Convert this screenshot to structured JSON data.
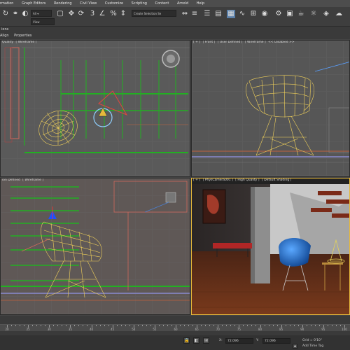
{
  "menubar": {
    "items": [
      "rmation",
      "Graph Editors",
      "Rendering",
      "Civil View",
      "Customize",
      "Scripting",
      "Content",
      "Arnold",
      "Help"
    ]
  },
  "toolbar": {
    "reference_system": "View",
    "selection_set": "Create Selection Se"
  },
  "tabs": {
    "row1_item": "ions",
    "row2_items": [
      "Align",
      "Properties"
    ]
  },
  "viewports": {
    "top": {
      "labels": [
        "Quality",
        "[ Wireframe ]"
      ]
    },
    "front": {
      "labels": [
        "[ + ]",
        "[ Front ]",
        "[ User Defined ]",
        "[ Wireframe ]",
        "<< Disabled >>"
      ]
    },
    "left": {
      "labels": [
        "ion Defined",
        "[ Wireframe ]"
      ]
    },
    "camera": {
      "labels": [
        "[ + ]",
        "[ PhysCamera001 ]",
        "[ High Quality ]",
        "[ Default Shading ]"
      ]
    }
  },
  "timeline": {
    "ticks": [
      "20",
      "25",
      "30",
      "35",
      "40",
      "45",
      "50",
      "55",
      "60",
      "65",
      "70",
      "75",
      "80",
      "85",
      "90",
      "95",
      "100"
    ]
  },
  "statusbar": {
    "x_label": "X:",
    "x_value": "72.096",
    "y_label": "Y:",
    "y_value": "72.096",
    "grid_label": "Grid = 0'10\"",
    "add_time_tag": "Add Time Tag"
  },
  "colors": {
    "wireframe_chair": "#f2d25a",
    "wireframe_green": "#1fa81f",
    "chair_blue": "#1e6fc9",
    "active_viewport": "#e6b93b"
  }
}
